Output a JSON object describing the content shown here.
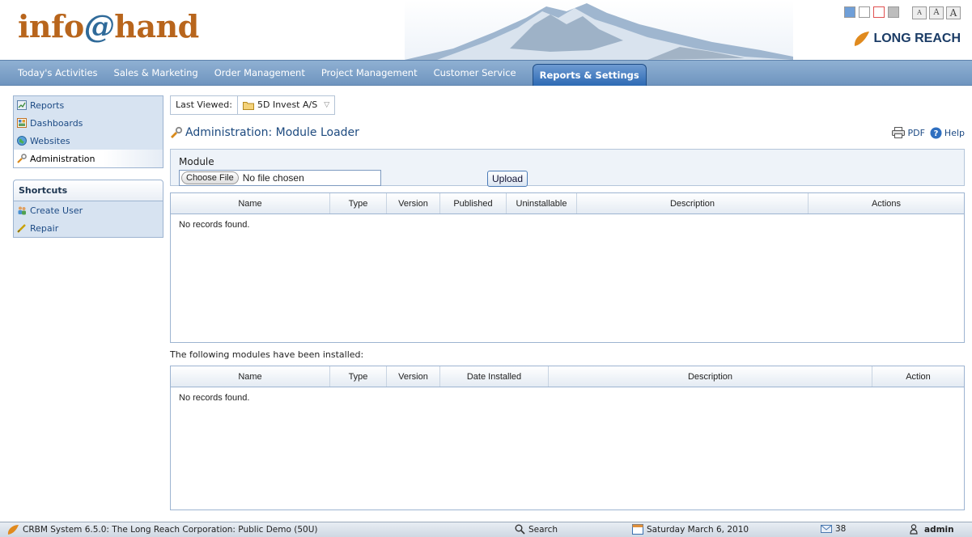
{
  "header": {
    "logo_main": "info",
    "logo_at": "@",
    "logo_end": "hand",
    "brand": "LONG REACH",
    "font_sizes": [
      "A",
      "A",
      "A"
    ],
    "theme_colors": [
      "#6f9fd8",
      "#ffffff",
      "#e05050",
      "#bdbdbd"
    ]
  },
  "nav": {
    "items": [
      {
        "label": "Today's Activities"
      },
      {
        "label": "Sales & Marketing"
      },
      {
        "label": "Order Management"
      },
      {
        "label": "Project Management"
      },
      {
        "label": "Customer Service"
      },
      {
        "label": "Reports & Settings"
      }
    ]
  },
  "sidebar": {
    "items": [
      {
        "label": "Reports"
      },
      {
        "label": "Dashboards"
      },
      {
        "label": "Websites"
      },
      {
        "label": "Administration"
      }
    ],
    "shortcuts_title": "Shortcuts",
    "shortcuts": [
      {
        "label": "Create User"
      },
      {
        "label": "Repair"
      }
    ]
  },
  "main": {
    "last_viewed_label": "Last Viewed:",
    "last_viewed_value": "5D Invest A/S",
    "title": "Administration: Module Loader",
    "pdf_label": "PDF",
    "help_label": "Help",
    "upload": {
      "module_label": "Module",
      "choose_file": "Choose File",
      "no_file": "No file chosen",
      "upload_button": "Upload"
    },
    "grid1": {
      "columns": [
        "Name",
        "Type",
        "Version",
        "Published",
        "Uninstallable",
        "Description",
        "Actions"
      ],
      "empty": "No records found."
    },
    "installed_caption": "The following modules have been installed:",
    "grid2": {
      "columns": [
        "Name",
        "Type",
        "Version",
        "Date Installed",
        "Description",
        "Action"
      ],
      "empty": "No records found."
    }
  },
  "statusbar": {
    "system": "CRBM System 6.5.0: The Long Reach Corporation: Public Demo (50U)",
    "search": "Search",
    "date": "Saturday March 6, 2010",
    "mail_count": "38",
    "user": "admin"
  },
  "colors": {
    "accent": "#2d6ab4",
    "nav_bg": "#7fa2c9",
    "logo_orange": "#b8651c"
  }
}
